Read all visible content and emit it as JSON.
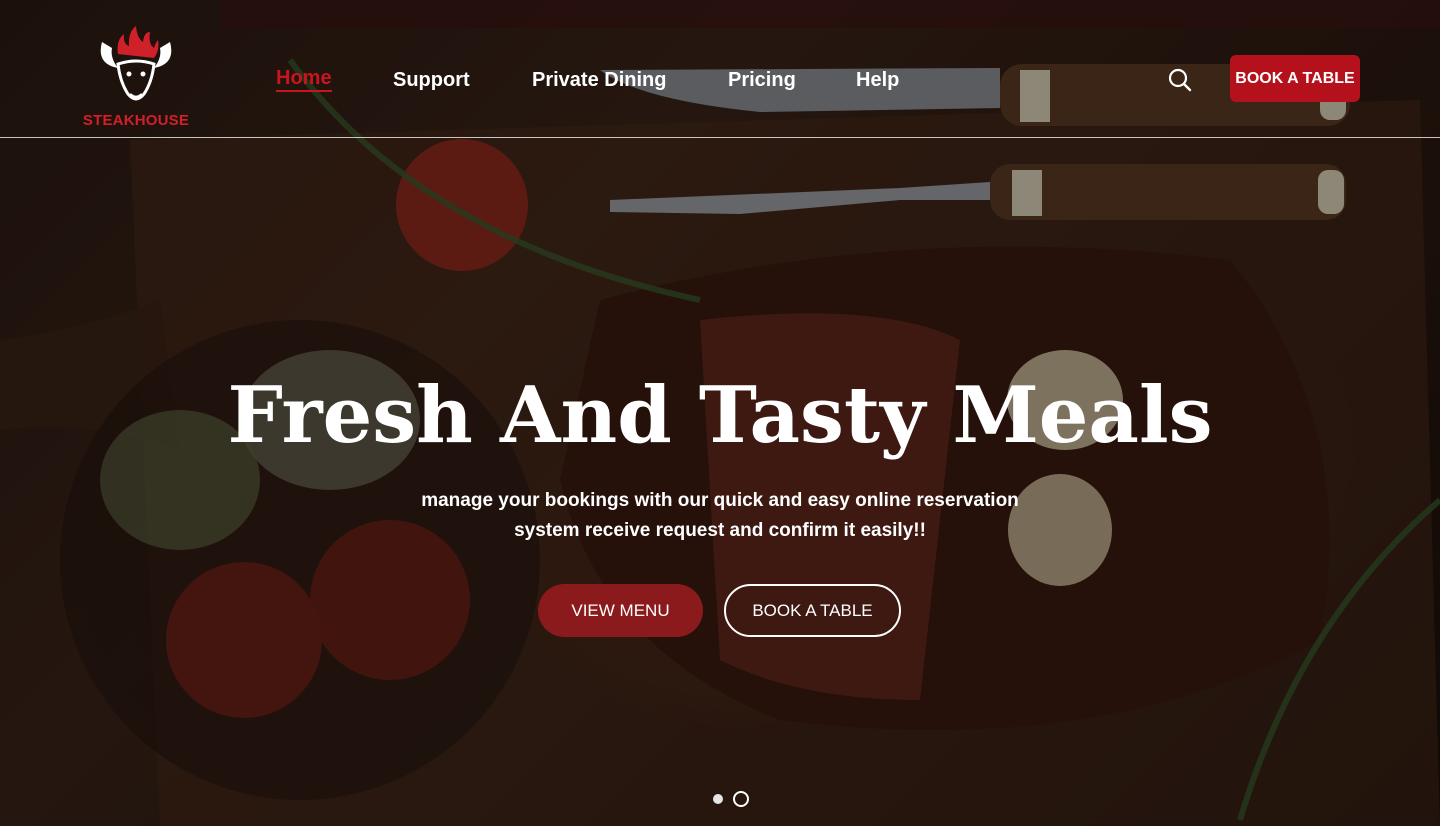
{
  "brand": {
    "name": "STEAKHOUSE",
    "logo_icon": "bull-flame-icon",
    "accent_color": "#d0202a"
  },
  "nav": {
    "items": [
      {
        "label": "Home",
        "active": true
      },
      {
        "label": "Support",
        "active": false
      },
      {
        "label": "Private Dining",
        "active": false
      },
      {
        "label": "Pricing",
        "active": false
      },
      {
        "label": "Help",
        "active": false
      }
    ],
    "search_icon": "search-icon",
    "book_label": "BOOK A TABLE",
    "book_color": "#b5111c"
  },
  "hero": {
    "title": "Fresh And Tasty Meals",
    "subtitle_line1": "manage your bookings with our quick and easy online reservation",
    "subtitle_line2": "system receive request and confirm it easily!!",
    "primary_button": "VIEW MENU",
    "primary_color": "#8b1a1c",
    "secondary_button": "BOOK A TABLE"
  },
  "carousel": {
    "slide_count": 2,
    "active_slide": 1
  }
}
